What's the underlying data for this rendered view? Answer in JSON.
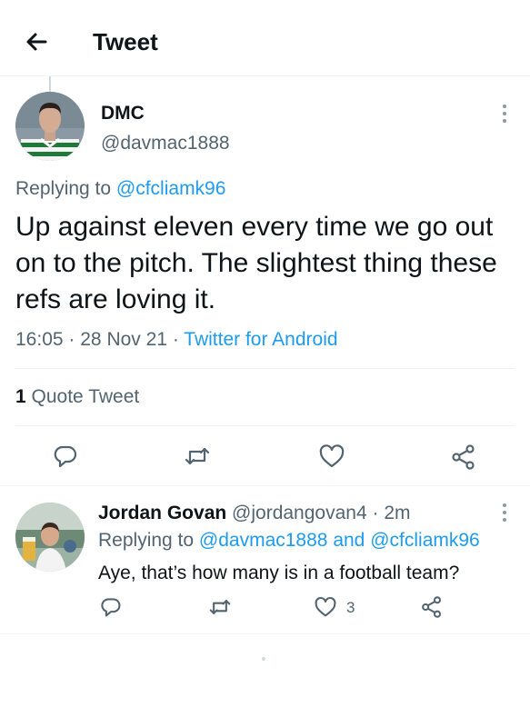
{
  "header": {
    "title": "Tweet"
  },
  "tweet": {
    "author_name": "DMC",
    "author_handle": "@davmac1888",
    "replying_prefix": "Replying to",
    "replying_to": "@cfcliamk96",
    "text": "Up against eleven every time we go out on to the pitch. The slightest thing these refs are loving it.",
    "time": "16:05",
    "date": "28 Nov 21",
    "separator": "·",
    "source": "Twitter for Android",
    "quote_count": "1",
    "quote_label": "Quote Tweet",
    "actions": [
      "reply-icon",
      "retweet-icon",
      "like-icon",
      "share-icon"
    ]
  },
  "reply": {
    "author_name": "Jordan Govan",
    "author_handle": "@jordangovan4",
    "separator": "·",
    "time_ago": "2m",
    "replying_prefix": "Replying to",
    "replying_to_1": "@davmac1888",
    "and": "and",
    "replying_to_2": "@cfcliamk96",
    "text": "Aye, that’s how many is in a football team?",
    "like_count": "3"
  },
  "colors": {
    "link": "#1d9bf0",
    "secondary_text": "#536471",
    "primary_text": "#0f1419",
    "divider": "#eff3f4"
  }
}
